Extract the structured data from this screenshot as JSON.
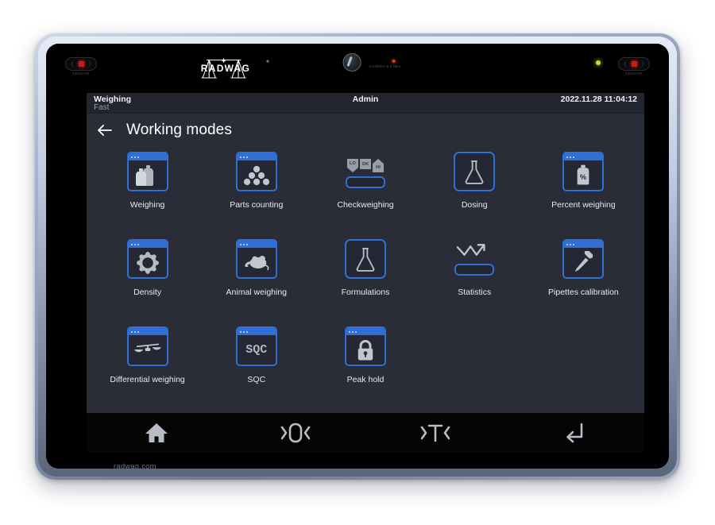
{
  "device": {
    "brand": "RADWAG",
    "footer_url": "radwag.com",
    "sensor_left_label": "SENSOR",
    "sensor_right_label": "SENSOR",
    "camera_label": "CAMERA 8.0 Mpx"
  },
  "status_bar": {
    "mode": "Weighing",
    "submode": "Fast",
    "user": "Admin",
    "datetime": "2022.11.28 11:04:12"
  },
  "header": {
    "title": "Working modes",
    "back_label": "Back"
  },
  "modes": [
    {
      "label": "Weighing",
      "icon": "bottles-icon",
      "style": "window"
    },
    {
      "label": "Parts counting",
      "icon": "balls-icon",
      "style": "window"
    },
    {
      "label": "Checkweighing",
      "icon": "lo-ok-hi-icon",
      "style": "composite-check",
      "segments": [
        "LO",
        "OK",
        "HI"
      ]
    },
    {
      "label": "Dosing",
      "icon": "flask-icon",
      "style": "plain"
    },
    {
      "label": "Percent weighing",
      "icon": "percent-bottle-icon",
      "style": "window"
    },
    {
      "label": "Density",
      "icon": "gear-icon",
      "style": "window"
    },
    {
      "label": "Animal weighing",
      "icon": "mouse-icon",
      "style": "window"
    },
    {
      "label": "Formulations",
      "icon": "flask-icon",
      "style": "plain"
    },
    {
      "label": "Statistics",
      "icon": "trend-chart-icon",
      "style": "composite-stats"
    },
    {
      "label": "Pipettes calibration",
      "icon": "pipette-icon",
      "style": "window"
    },
    {
      "label": "Differential weighing",
      "icon": "balance-scale-icon",
      "style": "window"
    },
    {
      "label": "SQC",
      "icon": "sqc-text-icon",
      "style": "window",
      "text": "SQC"
    },
    {
      "label": "Peak hold",
      "icon": "padlock-icon",
      "style": "window"
    }
  ],
  "nav_bar": [
    {
      "name": "home-button",
      "glyph": "home",
      "label": "Home"
    },
    {
      "name": "zero-button",
      "glyph": "zero",
      "label": "›0‹"
    },
    {
      "name": "tare-button",
      "glyph": "tare",
      "label": "›T‹"
    },
    {
      "name": "enter-button",
      "glyph": "enter",
      "label": "Enter"
    }
  ],
  "colors": {
    "accent_blue": "#2f6fd6",
    "screen_bg": "#2a2c38",
    "status_bg": "#222430",
    "nav_bg": "#050506",
    "icon_grey": "#b0b3bb",
    "led_red": "#d11a14",
    "led_green": "#b9e02a"
  }
}
